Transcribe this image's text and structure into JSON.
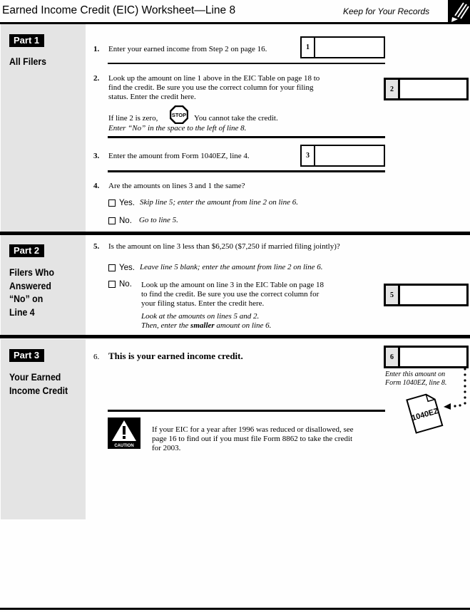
{
  "header": {
    "title": "Earned Income Credit (EIC) Worksheet—Line 8",
    "keep_note": "Keep for Your Records",
    "icon": "pencil-icon"
  },
  "parts": [
    {
      "badge": "Part 1",
      "title_lines": [
        "All Filers"
      ]
    },
    {
      "badge": "Part 2",
      "title_lines": [
        "Filers Who",
        "Answered",
        "“No” on",
        "Line 4"
      ]
    },
    {
      "badge": "Part 3",
      "title_lines": [
        "Your Earned",
        "Income Credit"
      ]
    }
  ],
  "lines": {
    "l1": {
      "num": "1.",
      "text": "Enter your earned income from Step 2 on page 16.",
      "box_label": "1",
      "value": ""
    },
    "l2": {
      "num": "2.",
      "text_lines": [
        "Look up the amount on line 1 above in the EIC Table on page 18 to",
        "find the credit. Be sure you use the correct column for your filing",
        "status. Enter the credit here."
      ],
      "box_label": "2",
      "value": "",
      "stop_prefix": "If line 2 is zero,",
      "stop_icon_text": "STOP",
      "stop_suffix": "You cannot take the credit.",
      "stop_italic": "Enter “No” in the space to the left of line 8."
    },
    "l3": {
      "num": "3.",
      "text": "Enter the amount from Form 1040EZ, line 4.",
      "box_label": "3",
      "value": ""
    },
    "l4": {
      "num": "4.",
      "text": "Are the amounts on lines 3 and 1 the same?",
      "yes_label": "Yes.",
      "yes_text": "Skip line 5; enter the amount from line 2 on line 6.",
      "no_label": "No.",
      "no_text": "Go to line 5."
    },
    "l5": {
      "num": "5.",
      "text": "Is the amount on line 3 less than $6,250 ($7,250 if married filing jointly)?",
      "yes_label": "Yes.",
      "yes_text": "Leave line 5 blank; enter the amount from line 2 on line 6.",
      "no_label": "No.",
      "no_text_lines": [
        "Look up the amount on line 3 in the EIC Table on page 18",
        "to find the credit. Be sure you use the correct column for",
        "your filing status. Enter the credit here."
      ],
      "note_line1": "Look at the amounts on lines 5 and 2.",
      "note_line2_pre": "Then, enter the ",
      "note_line2_bold": "smaller",
      "note_line2_post": " amount on line 6.",
      "box_label": "5",
      "value": ""
    },
    "l6": {
      "num": "6.",
      "text": "This is your earned income credit.",
      "box_label": "6",
      "value": "",
      "arrow_note_lines": [
        "Enter this amount on",
        "Form 1040EZ, line 8."
      ],
      "form_icon_text": "1040EZ"
    }
  },
  "caution": {
    "icon_text": "CAUTION",
    "text_lines": [
      "If your EIC for a year after 1996 was reduced or disallowed, see",
      "page 16 to find out if you must file Form 8862 to take the credit",
      "for 2003."
    ]
  }
}
